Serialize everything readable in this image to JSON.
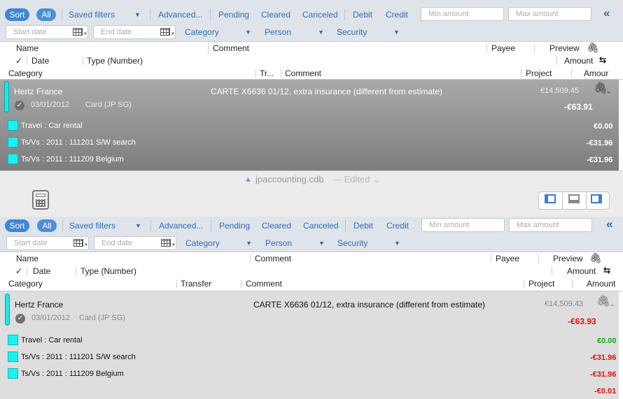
{
  "filter_bar": {
    "sort": "Sort",
    "all": "All",
    "saved_filters": "Saved filters",
    "advanced": "Advanced...",
    "pending": "Pending",
    "cleared": "Cleared",
    "canceled": "Canceled",
    "debit": "Debit",
    "credit": "Credit",
    "min_amount": "Min amount",
    "max_amount": "Max amount",
    "collapse": "«",
    "start_date": "Start date",
    "end_date": "End date",
    "category": "Category",
    "person": "Person",
    "security": "Security"
  },
  "columns": {
    "name": "Name",
    "comment": "Comment",
    "payee": "Payee",
    "preview": "Preview",
    "check": "✓",
    "date": "Date",
    "type_number": "Type (Number)",
    "amount": "Amount",
    "category": "Category",
    "transfer_short": "Tr...",
    "transfer": "Transfer",
    "split_comment": "Comment",
    "project": "Project",
    "amount_short": "Amour"
  },
  "transaction": {
    "payee": "Hertz France",
    "comment": "CARTE X6636 01/12, extra insurance (different from estimate)",
    "date": "03/01/2012",
    "type": "Card (JP SG)",
    "balance": "€14,509.45",
    "balance_bottom": "€14,509.43",
    "amount": "-€63.91",
    "amount_bottom": "-€63.93"
  },
  "splits": [
    {
      "category": "Travel : Car rental",
      "amount": "€0.00"
    },
    {
      "category": "Ts/Vs : 2011 : 111201 S/W search",
      "amount": "-€31.96"
    },
    {
      "category": "Ts/Vs : 2011 : 111209 Belgium",
      "amount": "-€31.96"
    }
  ],
  "remainder": "-€0.01",
  "window": {
    "title": "jpaccounting.cdb",
    "status": "— Edited ⌄"
  },
  "colors": {
    "accent": "#3f86d6",
    "cyan": "#19f2f2",
    "negative": "#e01010",
    "positive": "#10b010"
  },
  "icons": [
    "paperclip-icon",
    "swap-icon",
    "calendar-icon",
    "chevron-down-icon",
    "calculator-icon",
    "check-circle-icon",
    "document-icon",
    "layout-left-icon",
    "layout-bottom-icon",
    "layout-right-icon"
  ]
}
